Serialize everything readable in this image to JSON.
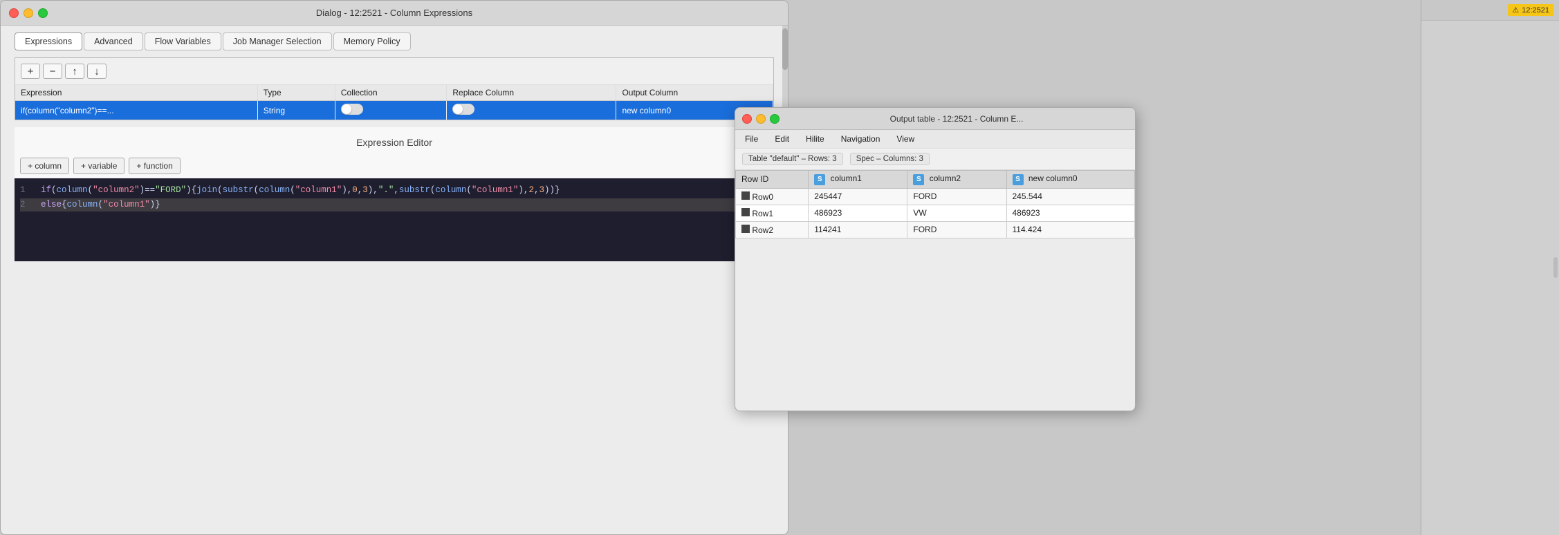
{
  "mainWindow": {
    "title": "Dialog - 12:2521 - Column Expressions"
  },
  "tabs": [
    {
      "label": "Expressions",
      "active": true
    },
    {
      "label": "Advanced",
      "active": false
    },
    {
      "label": "Flow Variables",
      "active": false
    },
    {
      "label": "Job Manager Selection",
      "active": false
    },
    {
      "label": "Memory Policy",
      "active": false
    }
  ],
  "toolbar": {
    "add": "+",
    "remove": "−",
    "up": "↑",
    "down": "↓"
  },
  "expressionsTable": {
    "columns": [
      "Expression",
      "Type",
      "Collection",
      "Replace Column",
      "Output Column"
    ],
    "rows": [
      {
        "expression": "if(column(\"column2\")==...",
        "type": "String",
        "collection": "",
        "replaceColumn": "",
        "outputColumn": "new column0",
        "selected": true
      }
    ]
  },
  "expressionEditor": {
    "title": "Expression Editor",
    "buttons": [
      {
        "label": "+ column"
      },
      {
        "label": "+ variable"
      },
      {
        "label": "+ function"
      }
    ],
    "lines": [
      {
        "num": "1",
        "content": "if(column(\"column2\")==\"FORD\"){join(substr(column(\"column1\"),0,3),\".\",substr(column(\"column1\"),2,3))}"
      },
      {
        "num": "2",
        "content": "else{column(\"column1\")}"
      }
    ]
  },
  "outputWindow": {
    "title": "Output table - 12:2521 - Column E...",
    "menu": [
      "File",
      "Edit",
      "Hilite",
      "Navigation",
      "View"
    ],
    "tableInfo": {
      "tableName": "Table \"default\" – Rows: 3",
      "spec": "Spec – Columns: 3"
    },
    "columns": [
      "Row ID",
      "column1",
      "column2",
      "new column0"
    ],
    "rows": [
      {
        "rowId": "Row0",
        "col1": "245447",
        "col2": "FORD",
        "col3": "245.544"
      },
      {
        "rowId": "Row1",
        "col1": "486923",
        "col2": "VW",
        "col3": "486923"
      },
      {
        "rowId": "Row2",
        "col1": "114241",
        "col2": "FORD",
        "col3": "114.424"
      }
    ]
  },
  "icons": {
    "close": "✕",
    "minimize": "",
    "maximize": "",
    "warning": "⚠",
    "plus": "+",
    "minus": "−",
    "arrowUp": "↑",
    "arrowDown": "↓"
  }
}
